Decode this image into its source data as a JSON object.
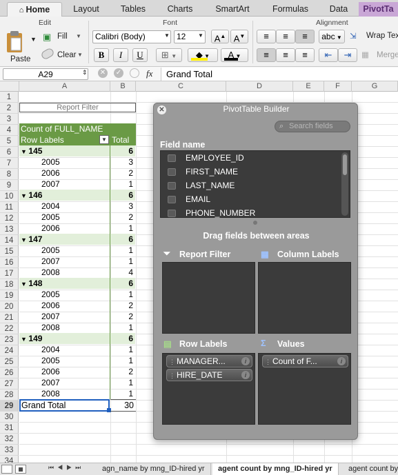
{
  "ribbon_tabs": [
    "Home",
    "Layout",
    "Tables",
    "Charts",
    "SmartArt",
    "Formulas",
    "Data",
    "PivotTa"
  ],
  "ribbon": {
    "edit_group": "Edit",
    "paste": "Paste",
    "fill": "Fill",
    "clear": "Clear",
    "font_group": "Font",
    "font_name": "Calibri (Body)",
    "font_size": "12",
    "bold": "B",
    "italic": "I",
    "underline": "U",
    "alignment_group": "Alignment",
    "abc": "abc",
    "wrap_text": "Wrap Text",
    "merge": "Merge"
  },
  "formula_bar": {
    "name_box": "A29",
    "fx": "fx",
    "content": "Grand Total"
  },
  "columns": [
    "A",
    "B",
    "C",
    "D",
    "E",
    "F",
    "G"
  ],
  "rows": [
    "1",
    "2",
    "3",
    "4",
    "5",
    "6",
    "7",
    "8",
    "9",
    "10",
    "11",
    "12",
    "13",
    "14",
    "15",
    "16",
    "17",
    "18",
    "19",
    "20",
    "21",
    "22",
    "23",
    "24",
    "25",
    "26",
    "27",
    "28",
    "29",
    "30",
    "31",
    "32",
    "33",
    "34"
  ],
  "pivot": {
    "report_filter": "Report Filter",
    "count_header": "Count of FULL_NAME",
    "row_labels": "Row Labels",
    "total": "Total",
    "groups": [
      {
        "label": "145",
        "total": "6",
        "items": [
          {
            "label": "2005",
            "total": "3"
          },
          {
            "label": "2006",
            "total": "2"
          },
          {
            "label": "2007",
            "total": "1"
          }
        ]
      },
      {
        "label": "146",
        "total": "6",
        "items": [
          {
            "label": "2004",
            "total": "3"
          },
          {
            "label": "2005",
            "total": "2"
          },
          {
            "label": "2006",
            "total": "1"
          }
        ]
      },
      {
        "label": "147",
        "total": "6",
        "items": [
          {
            "label": "2005",
            "total": "1"
          },
          {
            "label": "2007",
            "total": "1"
          },
          {
            "label": "2008",
            "total": "4"
          }
        ]
      },
      {
        "label": "148",
        "total": "6",
        "items": [
          {
            "label": "2005",
            "total": "1"
          },
          {
            "label": "2006",
            "total": "2"
          },
          {
            "label": "2007",
            "total": "2"
          },
          {
            "label": "2008",
            "total": "1"
          }
        ]
      },
      {
        "label": "149",
        "total": "6",
        "items": [
          {
            "label": "2004",
            "total": "1"
          },
          {
            "label": "2005",
            "total": "1"
          },
          {
            "label": "2006",
            "total": "2"
          },
          {
            "label": "2007",
            "total": "1"
          },
          {
            "label": "2008",
            "total": "1"
          }
        ]
      }
    ],
    "grand_total_label": "Grand Total",
    "grand_total": "30"
  },
  "builder": {
    "title": "PivotTable Builder",
    "search_placeholder": "Search fields",
    "field_name": "Field name",
    "fields": [
      "EMPLOYEE_ID",
      "FIRST_NAME",
      "LAST_NAME",
      "EMAIL",
      "PHONE_NUMBER"
    ],
    "drag_hint": "Drag fields between areas",
    "report_filter": "Report Filter",
    "column_labels": "Column Labels",
    "row_labels": "Row Labels",
    "values": "Values",
    "row_fields": [
      "MANAGER...",
      "HIRE_DATE"
    ],
    "value_fields": [
      "Count of F..."
    ]
  },
  "sheet_tabs": [
    "agn_name by mng_ID-hired yr",
    "agent count by mng_ID-hired yr",
    "agent count by"
  ],
  "colors": {
    "pivot_header": "#c6e0b4",
    "pivot_dark": "#6a9a45",
    "accent_pivot_tab": "#c9a7d6"
  }
}
